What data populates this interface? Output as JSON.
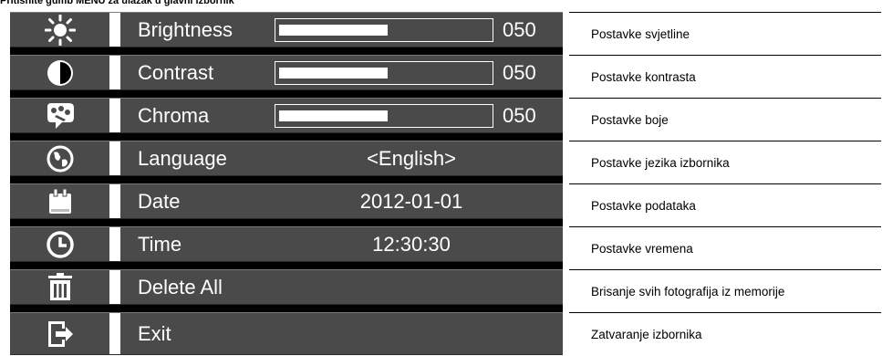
{
  "heading": "Pritisnite gumb MENU za ulazak u glavni izbornik",
  "menu": {
    "items": [
      {
        "label": "Brightness",
        "icon": "sun-icon",
        "type": "slider",
        "level": 0.5,
        "number": "050"
      },
      {
        "label": "Contrast",
        "icon": "contrast-icon",
        "type": "slider",
        "level": 0.5,
        "number": "050"
      },
      {
        "label": "Chroma",
        "icon": "chroma-icon",
        "type": "slider",
        "level": 0.5,
        "number": "050"
      },
      {
        "label": "Language",
        "icon": "globe-icon",
        "type": "value",
        "value": "<English>"
      },
      {
        "label": "Date",
        "icon": "calendar-icon",
        "type": "value",
        "value": "2012-01-01"
      },
      {
        "label": "Time",
        "icon": "clock-icon",
        "type": "value",
        "value": "12:30:30"
      },
      {
        "label": "Delete All",
        "icon": "trash-icon",
        "type": "none"
      },
      {
        "label": "Exit",
        "icon": "exit-icon",
        "type": "none"
      }
    ]
  },
  "descriptions": [
    "Postavke svjetline",
    "Postavke kontrasta",
    "Postavke boje",
    "Postavke jezika izbornika",
    "Postavke podataka",
    "Postavke vremena",
    "Brisanje svih fotografija iz memorije",
    "Zatvaranje izbornika"
  ],
  "colors": {
    "menu_background": "#4a4a4a",
    "menu_text": "#ffffff",
    "divider": "#ffffff"
  }
}
